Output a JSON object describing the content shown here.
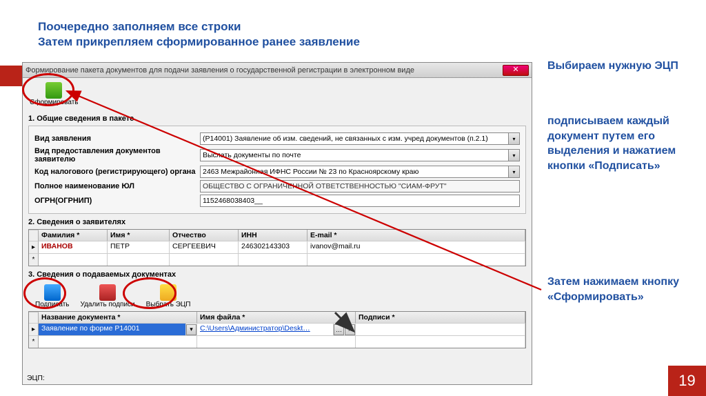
{
  "instructions": {
    "line1": "Поочередно заполняем все строки",
    "line2": "Затем прикрепляем сформированное ранее заявление"
  },
  "side": {
    "t1": "Выбираем нужную ЭЦП",
    "t2": "подписываем каждый документ путем его выделения и нажатием кнопки «Подписать»",
    "t3": "Затем нажимаем кнопку «Сформировать»"
  },
  "page_number": "19",
  "window": {
    "title": "Формирование пакета документов для подачи заявления о государственной регистрации в электронном виде",
    "toolbar": {
      "form": "Сформировать"
    },
    "section1": {
      "title": "1. Общие сведения в пакете",
      "rows": {
        "app_type_label": "Вид заявления",
        "app_type_value": "(Р14001) Заявление об изм. сведений, не связанных с изм. учред документов (п.2.1)",
        "delivery_label": "Вид предоставления документов заявителю",
        "delivery_value": "Выслать документы по почте",
        "tax_code_label": "Код налогового (регистрирующего) органа",
        "tax_code_value": "2463 Межрайонная ИФНС России № 23 по Красноярскому краю",
        "full_name_label": "Полное наименование ЮЛ",
        "full_name_value": "ОБЩЕСТВО С ОГРАНИЧЕННОЙ ОТВЕТСТВЕННОСТЬЮ \"СИАМ-ФРУТ\"",
        "ogrn_label": "ОГРН(ОГРНИП)",
        "ogrn_value": "1152468038403__"
      }
    },
    "section2": {
      "title": "2. Сведения о заявителях",
      "headers": {
        "fam": "Фамилия *",
        "name": "Имя *",
        "otch": "Отчество",
        "inn": "ИНН",
        "email": "E-mail *"
      },
      "row": {
        "fam": "ИВАНОВ",
        "name": "ПЕТР",
        "otch": "СЕРГЕЕВИЧ",
        "inn": "246302143303",
        "email": "ivanov@mail.ru"
      }
    },
    "section3": {
      "title": "3. Сведения о подаваемых документах",
      "toolbar": {
        "sign": "Подписать",
        "unsign": "Удалить подписи",
        "choose": "Выбрать ЭЦП"
      },
      "headers": {
        "doc": "Название документа *",
        "file": "Имя файла *",
        "sig": "Подписи *"
      },
      "row": {
        "doc": "Заявление по форме Р14001",
        "file": "C:\\Users\\Администратор\\Deskt…"
      }
    },
    "status_label": "ЭЦП:"
  }
}
